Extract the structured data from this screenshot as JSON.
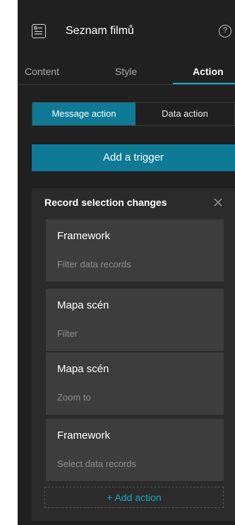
{
  "header": {
    "title": "Seznam filmů",
    "widget_icon": "list-widget-icon",
    "help_icon": "help-icon",
    "help_glyph": "?"
  },
  "tabs": [
    {
      "label": "Content",
      "active": false
    },
    {
      "label": "Style",
      "active": false
    },
    {
      "label": "Action",
      "active": true
    }
  ],
  "segment": {
    "message_action": "Message action",
    "data_action": "Data action",
    "selected": "Message action"
  },
  "add_trigger_label": "Add a trigger",
  "trigger": {
    "title": "Record selection changes",
    "close_icon": "close-icon",
    "actions": [
      {
        "name": "Framework",
        "type": "Filter data records"
      },
      {
        "name": "Mapa scén",
        "type": "Filter"
      },
      {
        "name": "Mapa scén",
        "type": "Zoom to"
      },
      {
        "name": "Framework",
        "type": "Select data records"
      }
    ],
    "add_action_label": "+ Add action"
  },
  "colors": {
    "panel_bg": "#202020",
    "accent": "#0e7a95",
    "accent_text": "#1ca6c4",
    "card_bg": "#2b2b2b",
    "item_bg": "#3d3d3d"
  }
}
